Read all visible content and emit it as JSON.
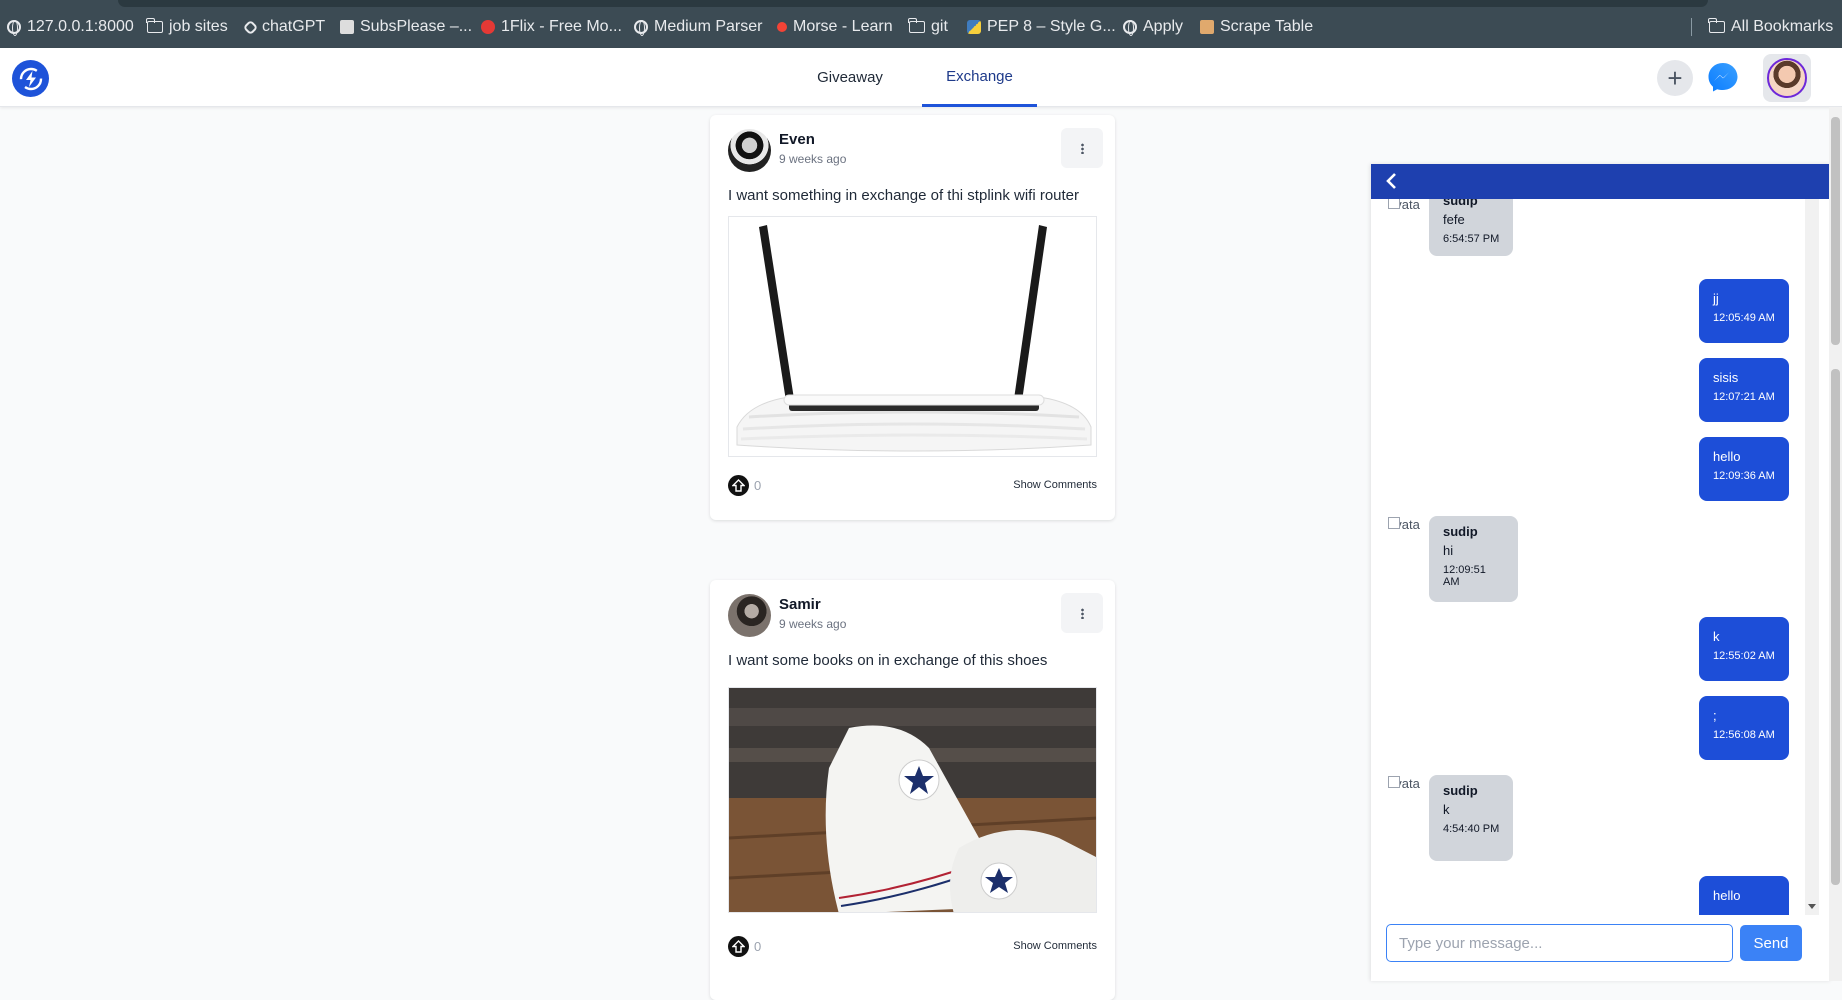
{
  "bookmarks": [
    {
      "label": "127.0.0.1:8000",
      "icon": "globe-icon"
    },
    {
      "label": "job sites",
      "icon": "folder-icon"
    },
    {
      "label": "chatGPT",
      "icon": "chatgpt-icon"
    },
    {
      "label": "SubsPlease –...",
      "icon": "page-icon"
    },
    {
      "label": "1Flix - Free Mo...",
      "icon": "flix-icon"
    },
    {
      "label": "Medium Parser",
      "icon": "globe-icon"
    },
    {
      "label": "Morse - Learn",
      "icon": "red-dot-icon"
    },
    {
      "label": "git",
      "icon": "folder-icon"
    },
    {
      "label": "PEP 8 – Style G...",
      "icon": "python-icon"
    },
    {
      "label": "Apply",
      "icon": "globe-icon"
    },
    {
      "label": "Scrape Table",
      "icon": "table-icon"
    }
  ],
  "all_bookmarks": "All Bookmarks",
  "nav": {
    "tabs": [
      {
        "label": "Giveaway",
        "active": false
      },
      {
        "label": "Exchange",
        "active": true
      }
    ]
  },
  "posts": [
    {
      "author": "Even",
      "time": "9 weeks ago",
      "text": "I want something in exchange of thi stplink wifi router",
      "image": "wifi-router",
      "upvotes": "0",
      "comments_label": "Show Comments"
    },
    {
      "author": "Samir",
      "time": "9 weeks ago",
      "text": "I want some books on in exchange of this shoes",
      "image": "white-sneakers",
      "upvotes": "0",
      "comments_label": "Show Comments"
    }
  ],
  "chat": {
    "messages": [
      {
        "dir": "in",
        "sender": "sudip",
        "text": "fefe",
        "time": "6:54:57 PM",
        "avatar_alt": "avata"
      },
      {
        "dir": "out",
        "text": "jj",
        "time": "12:05:49 AM"
      },
      {
        "dir": "out",
        "text": "sisis",
        "time": "12:07:21 AM"
      },
      {
        "dir": "out",
        "text": "hello",
        "time": "12:09:36 AM"
      },
      {
        "dir": "in",
        "sender": "sudip",
        "text": "hi",
        "time": "12:09:51 AM",
        "avatar_alt": "avata"
      },
      {
        "dir": "out",
        "text": "k",
        "time": "12:55:02 AM"
      },
      {
        "dir": "out",
        "text": ";",
        "time": "12:56:08 AM"
      },
      {
        "dir": "in",
        "sender": "sudip",
        "text": "k",
        "time": "4:54:40 PM",
        "avatar_alt": "avata"
      },
      {
        "dir": "out",
        "text": "hello",
        "time": ""
      }
    ],
    "input_placeholder": "Type your message...",
    "send_label": "Send"
  },
  "colors": {
    "primary": "#1e53d9",
    "chat_header": "#1e40af",
    "outgoing_bubble": "#1d4ed8",
    "incoming_bubble": "#d1d5db",
    "send_button": "#3b82f6"
  }
}
